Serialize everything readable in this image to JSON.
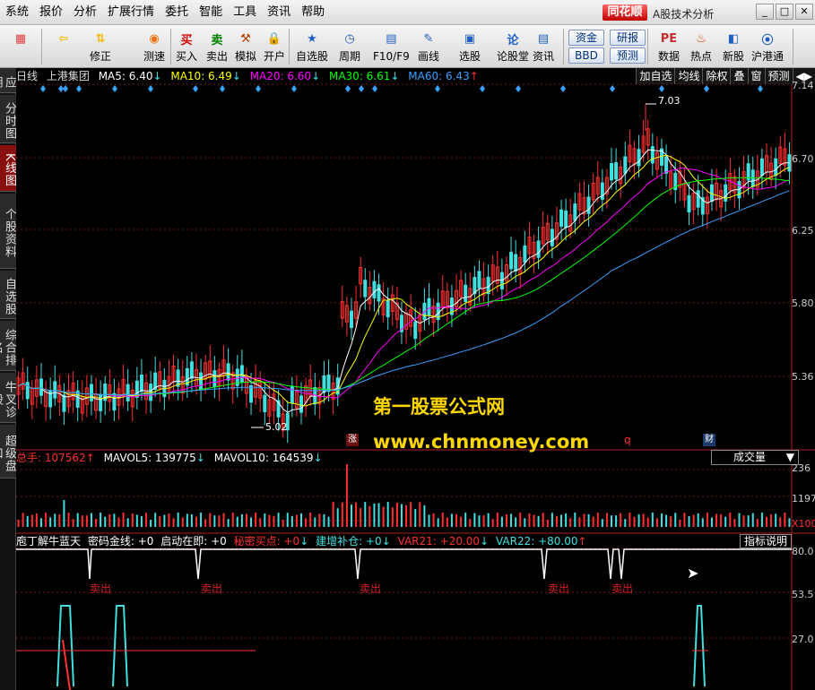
{
  "menu": [
    "系统",
    "报价",
    "分析",
    "扩展行情",
    "委托",
    "智能",
    "工具",
    "资讯",
    "帮助"
  ],
  "brand": "同花顺",
  "app_subtitle": "A股技术分析",
  "toolbar": [
    {
      "label": "",
      "icon": "grid-icon"
    },
    {
      "label": "",
      "icon": "back-icon"
    },
    {
      "label": "修正",
      "icon": "up-down-icon"
    },
    {
      "label": "测速",
      "icon": "speed-icon"
    },
    {
      "label": "买入",
      "icon": "buy-icon",
      "glyph": "买"
    },
    {
      "label": "卖出",
      "icon": "sell-icon",
      "glyph": "卖"
    },
    {
      "label": "模拟",
      "icon": "hammer-icon"
    },
    {
      "label": "开户",
      "icon": "lock-icon"
    },
    {
      "label": "自选股",
      "icon": "star-icon"
    },
    {
      "label": "周期",
      "icon": "clock-icon"
    },
    {
      "label": "F10/F9",
      "icon": "f10-icon"
    },
    {
      "label": "画线",
      "icon": "pen-icon"
    },
    {
      "label": "选股",
      "icon": "monitor-icon"
    },
    {
      "label": "论股堂",
      "icon": "forum-icon",
      "glyph": "论"
    },
    {
      "label": "资讯",
      "icon": "doc-icon"
    },
    {
      "label": "数据",
      "icon": "pe-icon",
      "glyph": "PE"
    },
    {
      "label": "热点",
      "icon": "hot-icon"
    },
    {
      "label": "新股",
      "icon": "ipo-icon"
    },
    {
      "label": "沪港通",
      "icon": "hk-icon"
    }
  ],
  "pills": {
    "fund": "资金",
    "bbd": "BBD",
    "research": "研报",
    "forecast": "预测"
  },
  "sidebar_tabs": [
    "应用",
    "分时图",
    "K线图",
    "个股资料",
    "自选股",
    "综合排名",
    "牛叉诊股",
    "超级盘口"
  ],
  "active_tab_index": 2,
  "header": {
    "period": "日线",
    "stock": "上港集团",
    "ma5": "MA5: 6.40",
    "ma5_arrow": "↓",
    "ma10": "MA10: 6.49",
    "ma10_arrow": "↓",
    "ma20": "MA20: 6.60",
    "ma20_arrow": "↓",
    "ma30": "MA30: 6.61",
    "ma30_arrow": "↓",
    "ma60": "MA60: 6.43",
    "ma60_arrow": "↑"
  },
  "controls": [
    "加自选",
    "均线",
    "除权",
    "叠",
    "窗",
    "预测",
    "◀▶"
  ],
  "price_axis": [
    "7.14",
    "6.70",
    "6.25",
    "5.80",
    "5.36"
  ],
  "annotations": {
    "high": "7.03",
    "low": "5.02",
    "zhang": "涨",
    "q": "q",
    "cai": "财"
  },
  "watermark": {
    "line1": "第一股票公式网",
    "line2": "www.chnmoney.com"
  },
  "volume_bar": {
    "total": "总手: 107562",
    "total_arrow": "↑",
    "mavol5": "MAVOL5: 139775",
    "mavol5_arrow": "↓",
    "mavol10": "MAVOL10: 164539",
    "mavol10_arrow": "↓",
    "selector": "成交量",
    "axis": [
      "236",
      "1197",
      "X100"
    ]
  },
  "indicator_bar": {
    "name": "庖丁解牛蓝天",
    "mima": "密码金线: +0",
    "qidong": "启动在即: +0",
    "mimi": "秘密买点: +0",
    "mimi_arrow": "↓",
    "jianzeng": "建增补仓: +0",
    "jianzeng_arrow": "↓",
    "var21": "VAR21: +20.00",
    "var21_arrow": "↓",
    "var22": "VAR22: +80.00",
    "var22_arrow": "↑",
    "explain": "指标说明",
    "axis": [
      "80.0",
      "53.5",
      "27.0"
    ]
  },
  "sell_label": "卖出",
  "colors": {
    "up": "#ff3030",
    "down": "#40e0e0",
    "ma5": "#ffffff",
    "ma10": "#ffff00",
    "ma20": "#ff00ff",
    "ma30": "#00ff00",
    "ma60": "#3aa0ff",
    "bg": "#000000",
    "grid": "#8a1a1a"
  }
}
